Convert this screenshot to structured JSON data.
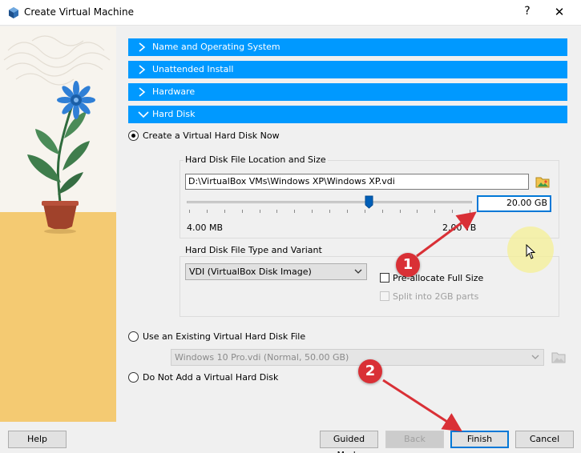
{
  "window": {
    "title": "Create Virtual Machine",
    "help_glyph": "?",
    "close_glyph": "✕"
  },
  "sections": [
    {
      "label": "Name and Operating System",
      "expanded": false
    },
    {
      "label": "Unattended Install",
      "expanded": false
    },
    {
      "label": "Hardware",
      "expanded": false
    },
    {
      "label": "Hard Disk",
      "expanded": true
    }
  ],
  "options": {
    "create_new": "Create a Virtual Hard Disk Now",
    "use_existing": "Use an Existing Virtual Hard Disk File",
    "no_disk": "Do Not Add a Virtual Hard Disk",
    "selected": "create_new"
  },
  "location_group": {
    "title": "Hard Disk File Location and Size",
    "path": "D:\\VirtualBox VMs\\Windows  XP\\Windows  XP.vdi",
    "size_value": "20.00 GB",
    "slider_min_label": "4.00 MB",
    "slider_max_label": "2.00 TB"
  },
  "type_group": {
    "title": "Hard Disk File Type and Variant",
    "type_selected": "VDI (VirtualBox Disk Image)",
    "preallocate_label": "Pre-allocate Full Size",
    "preallocate_checked": false,
    "split_label": "Split into 2GB parts",
    "split_checked": false
  },
  "existing_disk": {
    "selected": "Windows 10 Pro.vdi (Normal, 50.00 GB)"
  },
  "buttons": {
    "help": "Help",
    "guided": "Guided Mode",
    "back": "Back",
    "finish": "Finish",
    "cancel": "Cancel"
  },
  "annotations": {
    "step1": "1",
    "step2": "2"
  },
  "colors": {
    "section_header": "#0099ff",
    "annotation": "#d93036",
    "focus": "#0078d7"
  }
}
